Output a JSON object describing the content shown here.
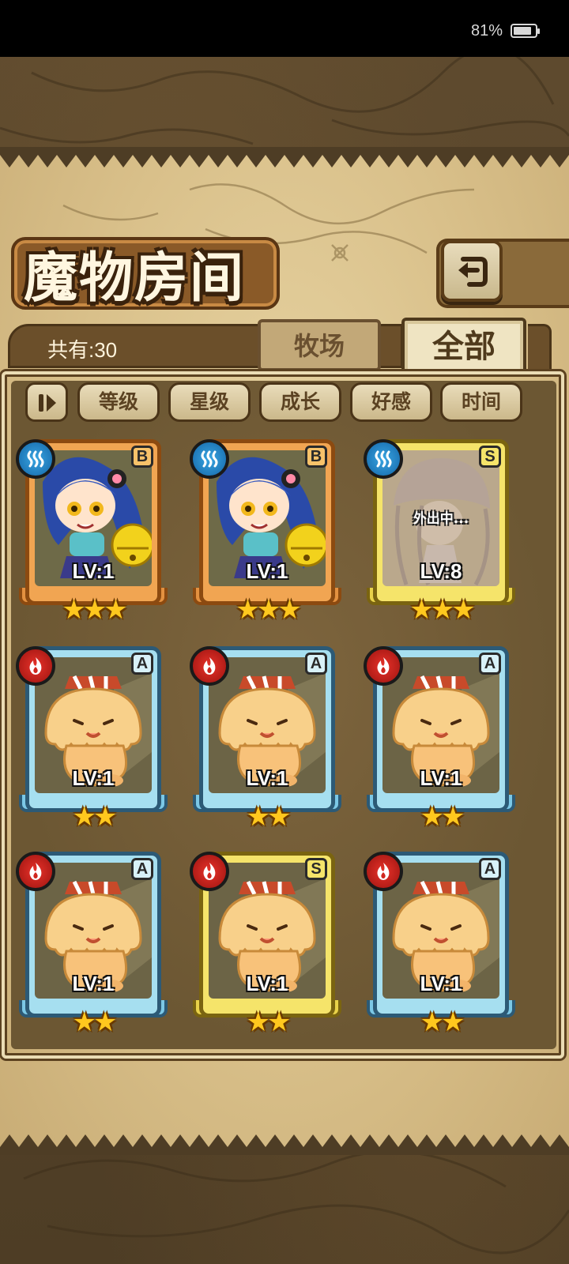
{
  "status_bar": {
    "battery_percent": "81%"
  },
  "page": {
    "title": "魔物房间"
  },
  "header": {
    "count_label": "共有:30"
  },
  "tabs": [
    {
      "label": "牧场",
      "active": false
    },
    {
      "label": "全部",
      "active": true
    }
  ],
  "sort_buttons": [
    {
      "label": "等级"
    },
    {
      "label": "星级"
    },
    {
      "label": "成长"
    },
    {
      "label": "好感"
    },
    {
      "label": "时间"
    }
  ],
  "monsters": [
    {
      "element": "water",
      "rank": "B",
      "level": "LV:1",
      "stars": "★★★",
      "frame": "orange",
      "art": "blue-haired catgirl with bell",
      "status": ""
    },
    {
      "element": "water",
      "rank": "B",
      "level": "LV:1",
      "stars": "★★★",
      "frame": "orange",
      "art": "blue-haired catgirl with bell",
      "status": ""
    },
    {
      "element": "water",
      "rank": "S",
      "level": "LV:8",
      "stars": "★★★",
      "frame": "yellow",
      "art": "jellyfish girl",
      "status": "外出中..."
    },
    {
      "element": "fire",
      "rank": "A",
      "level": "LV:1",
      "stars": "★★",
      "frame": "blue",
      "art": "pudding slime",
      "status": ""
    },
    {
      "element": "fire",
      "rank": "A",
      "level": "LV:1",
      "stars": "★★",
      "frame": "blue",
      "art": "pudding slime",
      "status": ""
    },
    {
      "element": "fire",
      "rank": "A",
      "level": "LV:1",
      "stars": "★★",
      "frame": "blue",
      "art": "pudding slime",
      "status": ""
    },
    {
      "element": "fire",
      "rank": "A",
      "level": "LV:1",
      "stars": "★★",
      "frame": "blue",
      "art": "pudding slime",
      "status": ""
    },
    {
      "element": "fire",
      "rank": "S",
      "level": "LV:1",
      "stars": "★★",
      "frame": "yellow",
      "art": "pudding slime",
      "status": ""
    },
    {
      "element": "fire",
      "rank": "A",
      "level": "LV:1",
      "stars": "★★",
      "frame": "blue",
      "art": "pudding slime",
      "status": ""
    }
  ],
  "icons": {
    "back": "back-arrow-icon",
    "sort_toggle": "sort-order-icon",
    "water": "water-element-icon",
    "fire": "fire-element-icon"
  },
  "colors": {
    "parchment": "#d9c08a",
    "frame_orange": "#f1a552",
    "frame_blue": "#a6dff0",
    "frame_yellow": "#f5e46a",
    "water": "#1f7cc4",
    "fire": "#d0261e"
  }
}
